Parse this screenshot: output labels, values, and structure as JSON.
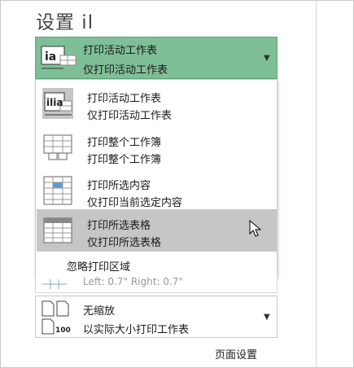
{
  "section": {
    "title": "设置 il"
  },
  "print_what": {
    "selected": {
      "line1": "打印活动工作表",
      "line2": "仅打印活动工作表",
      "icon_text": "ia"
    },
    "options": [
      {
        "line1": "打印活动工作表",
        "line2": "仅打印活动工作表",
        "icon": "active-sheet-icon",
        "icon_text": "ilia"
      },
      {
        "line1": "打印整个工作簿",
        "line2": "打印整个工作簿",
        "icon": "workbook-icon"
      },
      {
        "line1": "打印所选内容",
        "line2": "仅打印当前选定内容",
        "icon": "selection-icon"
      },
      {
        "line1": "打印所选表格",
        "line2": "仅打印所选表格",
        "icon": "table-icon"
      }
    ],
    "ignore_print_area": "忽略打印区域"
  },
  "margins": {
    "text": "Left:  0.7\"    Right:  0.7\""
  },
  "scaling": {
    "line1": "无缩放",
    "line2": "以实际大小打印工作表",
    "icon_badge": "100"
  },
  "footer": {
    "page_setup": "页面设置"
  },
  "colors": {
    "selected_bg": "#7fbf98",
    "hover_bg": "#c6c6c6",
    "accent_blue": "#5b9bd5"
  }
}
